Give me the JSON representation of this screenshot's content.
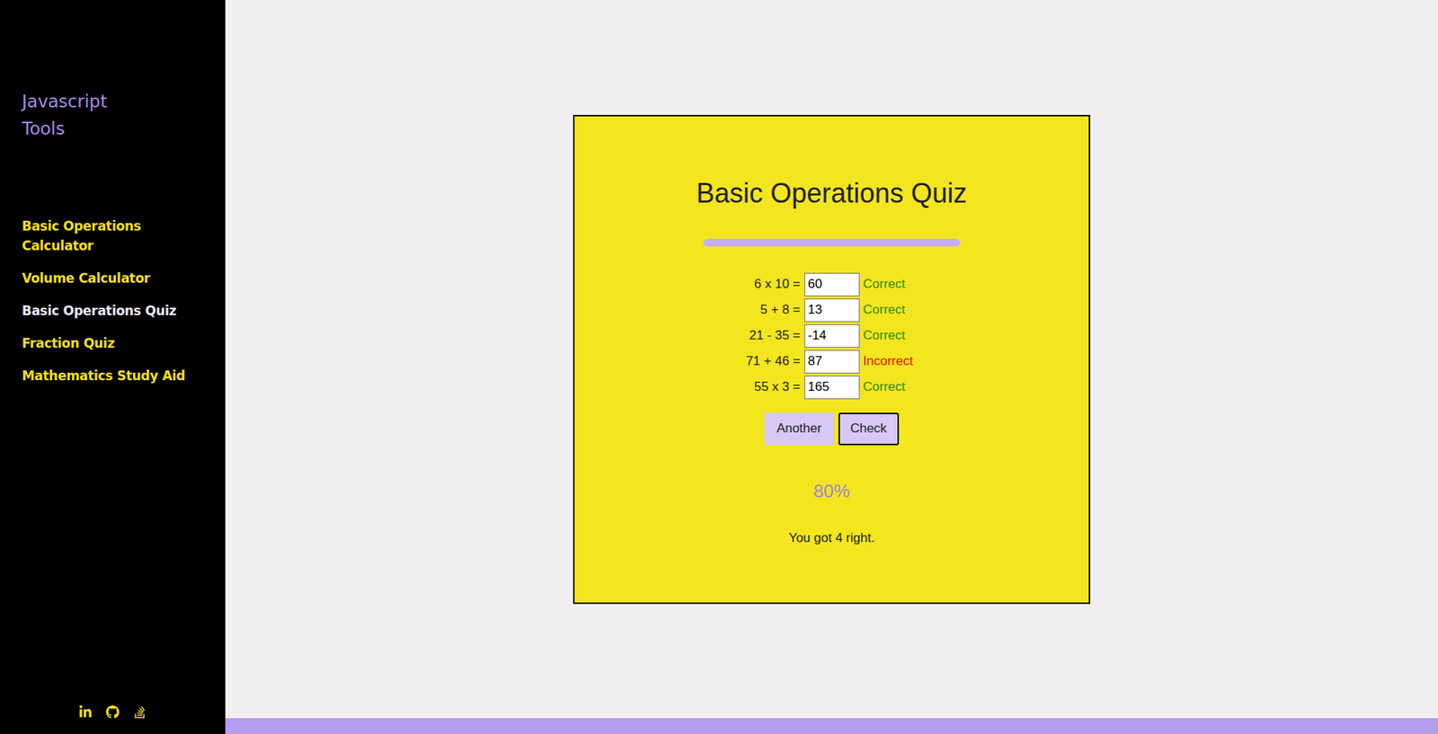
{
  "sidebar": {
    "title": "Javascript Tools",
    "items": [
      {
        "label": "Basic Operations Calculator",
        "selected": false
      },
      {
        "label": "Volume Calculator",
        "selected": false
      },
      {
        "label": "Basic Operations Quiz",
        "selected": true
      },
      {
        "label": "Fraction Quiz",
        "selected": false
      },
      {
        "label": "Mathematics Study Aid",
        "selected": false
      }
    ]
  },
  "quiz": {
    "title": "Basic Operations Quiz",
    "level": 1,
    "questions": [
      {
        "prompt": "6 x 10 =",
        "answer": "60",
        "result": "Correct",
        "correct": true
      },
      {
        "prompt": "5 + 8 =",
        "answer": "13",
        "result": "Correct",
        "correct": true
      },
      {
        "prompt": "21 - 35 =",
        "answer": "-14",
        "result": "Correct",
        "correct": true
      },
      {
        "prompt": "71 + 46 =",
        "answer": "87",
        "result": "Incorrect",
        "correct": false
      },
      {
        "prompt": "55 x 3 =",
        "answer": "165",
        "result": "Correct",
        "correct": true
      }
    ],
    "buttons": [
      {
        "label": "Another",
        "focused": false
      },
      {
        "label": "Check",
        "focused": true
      }
    ],
    "score": "80%",
    "summary": "You got 4 right."
  }
}
